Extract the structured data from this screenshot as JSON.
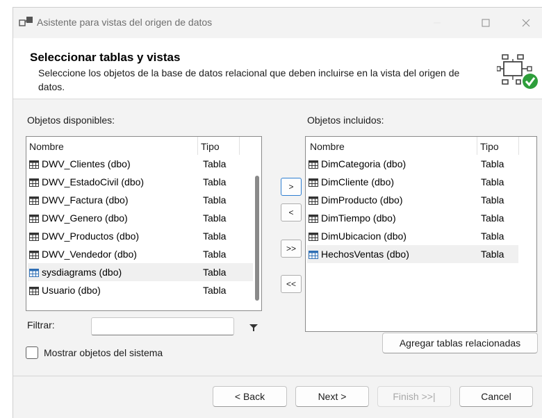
{
  "window": {
    "title": "Asistente para vistas del origen de datos"
  },
  "header": {
    "title": "Seleccionar tablas y vistas",
    "subtitle": "Seleccione los objetos de la base de datos relacional que deben incluirse en la vista del origen de datos."
  },
  "available": {
    "label": "Objetos disponibles:",
    "col_name": "Nombre",
    "col_type": "Tipo",
    "items": [
      {
        "name": "DWV_Clientes (dbo)",
        "type": "Tabla"
      },
      {
        "name": "DWV_EstadoCivil (dbo)",
        "type": "Tabla"
      },
      {
        "name": "DWV_Factura (dbo)",
        "type": "Tabla"
      },
      {
        "name": "DWV_Genero (dbo)",
        "type": "Tabla"
      },
      {
        "name": "DWV_Productos (dbo)",
        "type": "Tabla"
      },
      {
        "name": "DWV_Vendedor (dbo)",
        "type": "Tabla"
      },
      {
        "name": "sysdiagrams (dbo)",
        "type": "Tabla"
      },
      {
        "name": "Usuario (dbo)",
        "type": "Tabla"
      }
    ]
  },
  "included": {
    "label": "Objetos incluidos:",
    "col_name": "Nombre",
    "col_type": "Tipo",
    "items": [
      {
        "name": "DimCategoria (dbo)",
        "type": "Tabla"
      },
      {
        "name": "DimCliente (dbo)",
        "type": "Tabla"
      },
      {
        "name": "DimProducto (dbo)",
        "type": "Tabla"
      },
      {
        "name": "DimTiempo (dbo)",
        "type": "Tabla"
      },
      {
        "name": "DimUbicacion (dbo)",
        "type": "Tabla"
      },
      {
        "name": "HechosVentas (dbo)",
        "type": "Tabla"
      }
    ]
  },
  "transfer": {
    "add": ">",
    "remove": "<",
    "add_all": ">>",
    "remove_all": "<<"
  },
  "filter": {
    "label": "Filtrar:",
    "value": ""
  },
  "show_system": {
    "label": "Mostrar objetos del sistema"
  },
  "related_button": "Agregar tablas relacionadas",
  "nav": {
    "back": "< Back",
    "next": "Next >",
    "finish": "Finish >>|",
    "cancel": "Cancel"
  },
  "colors": {
    "accent": "#2f7fd1",
    "success": "#2e9e3b",
    "selected_row": "#f0f0f0"
  }
}
